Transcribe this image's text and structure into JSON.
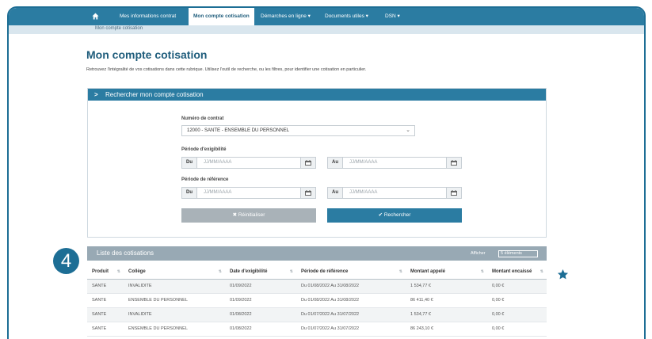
{
  "nav": {
    "items": [
      "Mes informations contrat",
      "Mon compte cotisation",
      "Démarches en ligne ▾",
      "Documents utiles ▾",
      "DSN ▾"
    ],
    "active_index": 1
  },
  "breadcrumb": "Mon compte cotisation",
  "page": {
    "title": "Mon compte cotisation",
    "description": "Retrouvez l'intégralité de vos cotisations dans cette rubrique. Utilisez l'outil de recherche, ou les filtres, pour identifier une cotisation en particulier."
  },
  "search": {
    "panel_title": "Rechercher mon compte cotisation",
    "contract_label": "Numéro de contrat",
    "contract_value": "12000 - SANTE - ENSEMBLE DU PERSONNEL",
    "eligibility_label": "Période d'exigibilité",
    "reference_label": "Période de référence",
    "from_label": "Du",
    "to_label": "Au",
    "date_placeholder": "JJ/MM/AAAA",
    "reset_label": "✖ Réinitialiser",
    "search_label": "✔ Rechercher"
  },
  "list": {
    "title": "Liste des cotisations",
    "show_label": "Afficher",
    "show_value": "5 éléments",
    "columns": [
      "Produit",
      "Collège",
      "Date d'exigibilité",
      "Période de référence",
      "Montant appelé",
      "Montant encaissé"
    ],
    "rows": [
      [
        "SANTE",
        "INVALIDITE",
        "01/09/2022",
        "Du 01/08/2022 Au 31/08/2022",
        "1 534,77 €",
        "0,00 €"
      ],
      [
        "SANTE",
        "ENSEMBLE DU PERSONNEL",
        "01/09/2022",
        "Du 01/08/2022 Au 31/08/2022",
        "86 411,40 €",
        "0,00 €"
      ],
      [
        "SANTE",
        "INVALIDITE",
        "01/08/2022",
        "Du 01/07/2022 Au 31/07/2022",
        "1 534,77 €",
        "0,00 €"
      ],
      [
        "SANTE",
        "ENSEMBLE DU PERSONNEL",
        "01/08/2022",
        "Du 01/07/2022 Au 31/07/2022",
        "86 243,10 €",
        "0,00 €"
      ]
    ]
  },
  "marker": "4",
  "colors": {
    "primary": "#2b7ca2",
    "frame": "#1d6e95",
    "list_header": "#98a9b4",
    "reset": "#a9b2b8"
  }
}
